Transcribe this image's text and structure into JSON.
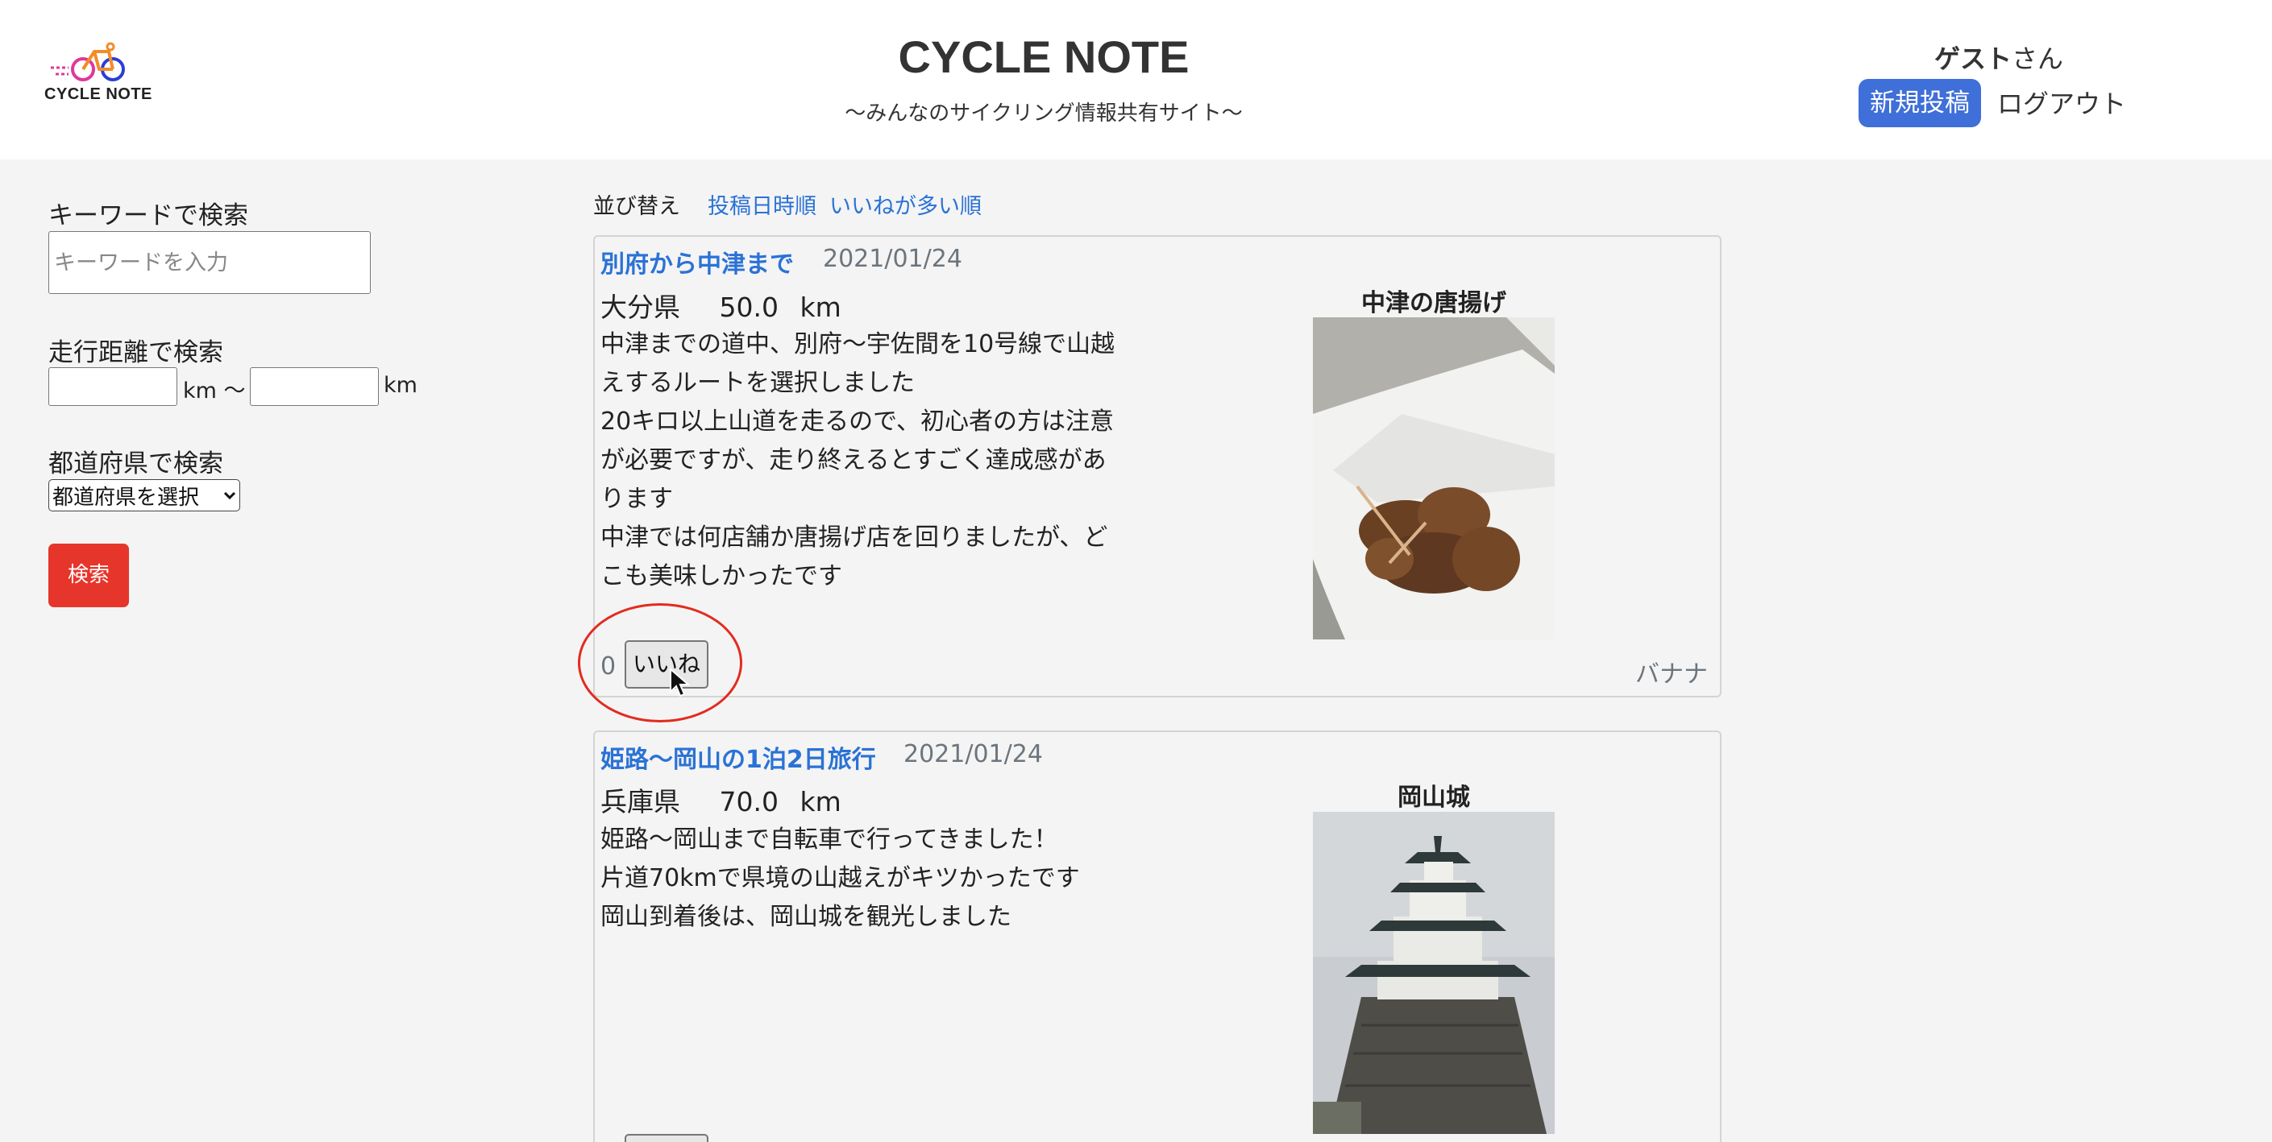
{
  "header": {
    "logo_text": "CYCLE NOTE",
    "site_title": "CYCLE NOTE",
    "site_subtitle": "〜みんなのサイクリング情報共有サイト〜",
    "user_name": "ゲスト",
    "user_suffix": "さん",
    "new_post_label": "新規投稿",
    "logout_label": "ログアウト"
  },
  "sidebar": {
    "keyword_label": "キーワードで検索",
    "keyword_placeholder": "キーワードを入力",
    "distance_label": "走行距離で検索",
    "km_unit": "km",
    "km_tilde": "km 〜",
    "prefecture_label": "都道府県で検索",
    "prefecture_selected": "都道府県を選択",
    "search_button": "検索"
  },
  "sort": {
    "label": "並び替え",
    "options": [
      "投稿日時順",
      "いいねが多い順"
    ]
  },
  "posts": [
    {
      "title": "別府から中津まで",
      "date": "2021/01/24",
      "prefecture": "大分県",
      "distance": "50.0",
      "unit": "km",
      "body_lines": [
        "中津までの道中、別府〜宇佐間を10号線で山越",
        "えするルートを選択しました",
        "20キロ以上山道を走るので、初心者の方は注意",
        "が必要ですが、走り終えるとすごく達成感があ",
        "ります",
        "中津では何店舗か唐揚げ店を回りましたが、ど",
        "こも美味しかったです"
      ],
      "image_caption": "中津の唐揚げ",
      "like_count": "0",
      "like_label": "いいね",
      "author": "バナナ"
    },
    {
      "title": "姫路〜岡山の1泊2日旅行",
      "date": "2021/01/24",
      "prefecture": "兵庫県",
      "distance": "70.0",
      "unit": "km",
      "body_lines": [
        "姫路〜岡山まで自転車で行ってきました！",
        "片道70kmで県境の山越えがキツかったです",
        "岡山到着後は、岡山城を観光しました"
      ],
      "image_caption": "岡山城"
    }
  ],
  "colors": {
    "link": "#2a72d6",
    "new_post_button": "#3f6fd8",
    "search_button": "#e6352b",
    "annotation": "#e32b1f"
  }
}
